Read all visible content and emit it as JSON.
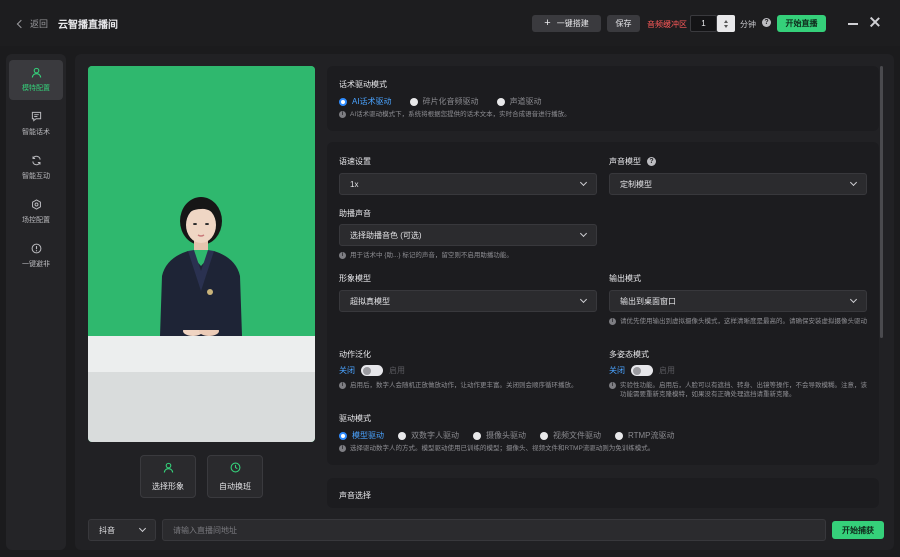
{
  "titlebar": {
    "back_label": "返回",
    "app_title": "云智播直播间",
    "one_click_label": "一键搭建",
    "save_label": "保存",
    "audio_buffer_label": "音频缓冲区",
    "buffer_value": "1",
    "minutes_label": "分钟",
    "start_live_label": "开始直播"
  },
  "sidebar": {
    "items": [
      {
        "label": "模特配置",
        "icon": "user-icon",
        "active": true
      },
      {
        "label": "智能话术",
        "icon": "chat-icon",
        "active": false
      },
      {
        "label": "智能互动",
        "icon": "refresh-icon",
        "active": false
      },
      {
        "label": "场控配置",
        "icon": "gear-icon",
        "active": false
      },
      {
        "label": "一键避非",
        "icon": "alert-icon",
        "active": false
      }
    ]
  },
  "preview": {
    "select_avatar_label": "选择形象",
    "auto_shift_label": "自动换班"
  },
  "script_mode": {
    "title": "话术驱动模式",
    "options": [
      "AI话术驱动",
      "碎片化音频驱动",
      "声道驱动"
    ],
    "selected": 0,
    "hint": "AI话术驱动模式下，系统将根据您提供的话术文本，实时合成语音进行播放。"
  },
  "settings": {
    "speed_label": "语速设置",
    "speed_value": "1x",
    "voice_model_label": "声音模型",
    "voice_model_value": "定制模型",
    "assist_voice_label": "助播声音",
    "assist_voice_placeholder": "选择助播音色 (可选)",
    "assist_voice_hint": "用于话术中 {助...} 标记的声音，留空则不启用助播功能。",
    "avatar_model_label": "形象模型",
    "avatar_model_value": "超拟真模型",
    "output_mode_label": "输出模式",
    "output_mode_value": "输出到桌面窗口",
    "output_mode_hint": "请优先使用输出到虚拟摄像头模式，这样清晰度是最高的。请确保安装虚拟摄像头驱动",
    "motion_label": "动作泛化",
    "motion_off": "关闭",
    "motion_on": "启用",
    "motion_hint": "启用后，数字人会随机正放做放动作，让动作更丰富。关闭则会顺序循环播放。",
    "multi_pose_label": "多姿态模式",
    "multi_pose_off": "关闭",
    "multi_pose_on": "启用",
    "multi_pose_hint": "实验性功能。启用后，人脸可以有遮挡、转身、出镜等操作，不会导致模糊。注意，该功能需要重新克隆模特，如果没有正确处理遮挡请重新克隆。",
    "drive_mode_label": "驱动模式",
    "drive_modes": [
      "模型驱动",
      "双数字人驱动",
      "摄像头驱动",
      "视频文件驱动",
      "RTMP流驱动"
    ],
    "drive_selected": 0,
    "drive_hint": "选择驱动数字人的方式。模型驱动使用已训练的模型；摄像头、视频文件和RTMP流驱动则为免训练模式。"
  },
  "voice_select": {
    "title": "声音选择"
  },
  "bottom": {
    "platform_value": "抖音",
    "url_placeholder": "请输入直播间地址",
    "capture_label": "开始捕获"
  },
  "colors": {
    "accent_green": "#35d07a",
    "accent_blue": "#2f8cff",
    "warning_red": "#ff5a5a",
    "chroma_green": "#2fb86e"
  }
}
